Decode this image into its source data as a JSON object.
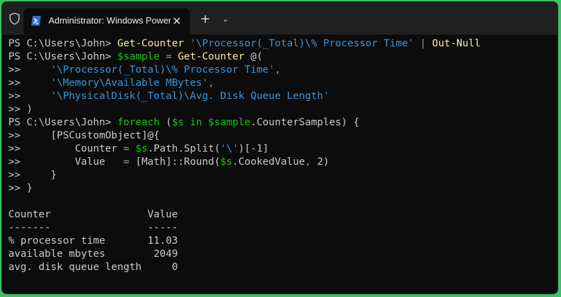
{
  "window": {
    "tab_title": "Administrator: Windows PowerShell",
    "close_glyph": "✕",
    "new_tab_glyph": "+",
    "dropdown_glyph": "⌄"
  },
  "terminal": {
    "lines": [
      [
        {
          "t": "PS C:\\Users\\John> ",
          "c": "pr"
        },
        {
          "t": "Get-Counter",
          "c": "cmd"
        },
        {
          "t": " ",
          "c": "def"
        },
        {
          "t": "'\\Processor(_Total)\\% Processor Time'",
          "c": "str"
        },
        {
          "t": " | ",
          "c": "op"
        },
        {
          "t": "Out-Null",
          "c": "cmd"
        }
      ],
      [
        {
          "t": "PS C:\\Users\\John> ",
          "c": "pr"
        },
        {
          "t": "$sample",
          "c": "var"
        },
        {
          "t": " = ",
          "c": "op"
        },
        {
          "t": "Get-Counter",
          "c": "cmd"
        },
        {
          "t": " @(",
          "c": "def"
        }
      ],
      [
        {
          "t": ">>     ",
          "c": "pr"
        },
        {
          "t": "'\\Processor(_Total)\\% Processor Time'",
          "c": "str"
        },
        {
          "t": ",",
          "c": "op"
        }
      ],
      [
        {
          "t": ">>     ",
          "c": "pr"
        },
        {
          "t": "'\\Memory\\Available MBytes'",
          "c": "str"
        },
        {
          "t": ",",
          "c": "op"
        }
      ],
      [
        {
          "t": ">>     ",
          "c": "pr"
        },
        {
          "t": "'\\PhysicalDisk(_Total)\\Avg. Disk Queue Length'",
          "c": "str"
        }
      ],
      [
        {
          "t": ">> )",
          "c": "pr"
        }
      ],
      [
        {
          "t": "PS C:\\Users\\John> ",
          "c": "pr"
        },
        {
          "t": "foreach",
          "c": "kw"
        },
        {
          "t": " (",
          "c": "def"
        },
        {
          "t": "$s",
          "c": "var"
        },
        {
          "t": " in ",
          "c": "kw"
        },
        {
          "t": "$sample",
          "c": "var"
        },
        {
          "t": ".CounterSamples) {",
          "c": "def"
        }
      ],
      [
        {
          "t": ">>     ",
          "c": "pr"
        },
        {
          "t": "[PSCustomObject]@{",
          "c": "def"
        }
      ],
      [
        {
          "t": ">>         ",
          "c": "pr"
        },
        {
          "t": "Counter",
          "c": "def"
        },
        {
          "t": " = ",
          "c": "op"
        },
        {
          "t": "$s",
          "c": "var"
        },
        {
          "t": ".Path.Split(",
          "c": "def"
        },
        {
          "t": "'\\'",
          "c": "str"
        },
        {
          "t": ")[-1]",
          "c": "def"
        }
      ],
      [
        {
          "t": ">>         ",
          "c": "pr"
        },
        {
          "t": "Value",
          "c": "def"
        },
        {
          "t": "   = ",
          "c": "op"
        },
        {
          "t": "[Math]::Round(",
          "c": "def"
        },
        {
          "t": "$s",
          "c": "var"
        },
        {
          "t": ".CookedValue",
          "c": "def"
        },
        {
          "t": ", ",
          "c": "op"
        },
        {
          "t": "2)",
          "c": "def"
        }
      ],
      [
        {
          "t": ">>     }",
          "c": "pr"
        }
      ],
      [
        {
          "t": ">> }",
          "c": "pr"
        }
      ],
      [
        {
          "t": "",
          "c": "def"
        }
      ],
      [
        {
          "t": "Counter                Value",
          "c": "def"
        }
      ],
      [
        {
          "t": "-------                -----",
          "c": "def"
        }
      ],
      [
        {
          "t": "% processor time       11.03",
          "c": "def"
        }
      ],
      [
        {
          "t": "available mbytes        2049",
          "c": "def"
        }
      ],
      [
        {
          "t": "avg. disk queue length     0",
          "c": "def"
        }
      ]
    ]
  }
}
